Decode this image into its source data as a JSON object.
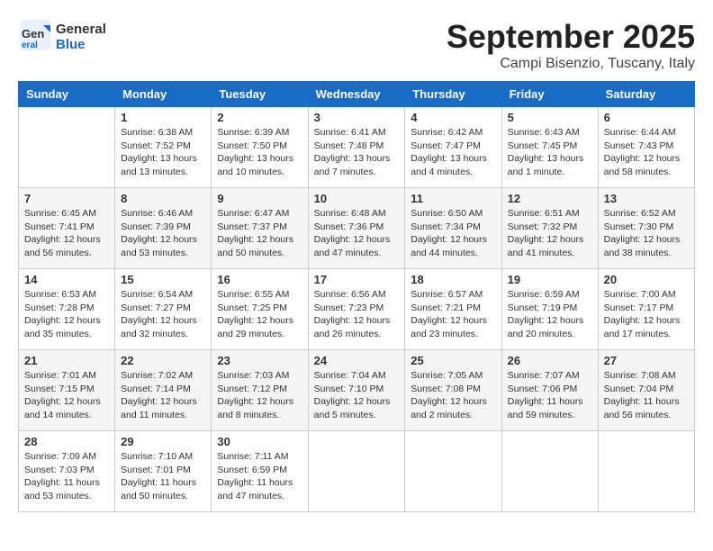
{
  "header": {
    "logo_line1": "General",
    "logo_line2": "Blue",
    "month": "September 2025",
    "location": "Campi Bisenzio, Tuscany, Italy"
  },
  "days_of_week": [
    "Sunday",
    "Monday",
    "Tuesday",
    "Wednesday",
    "Thursday",
    "Friday",
    "Saturday"
  ],
  "weeks": [
    [
      {
        "day": "",
        "info": ""
      },
      {
        "day": "1",
        "info": "Sunrise: 6:38 AM\nSunset: 7:52 PM\nDaylight: 13 hours\nand 13 minutes."
      },
      {
        "day": "2",
        "info": "Sunrise: 6:39 AM\nSunset: 7:50 PM\nDaylight: 13 hours\nand 10 minutes."
      },
      {
        "day": "3",
        "info": "Sunrise: 6:41 AM\nSunset: 7:48 PM\nDaylight: 13 hours\nand 7 minutes."
      },
      {
        "day": "4",
        "info": "Sunrise: 6:42 AM\nSunset: 7:47 PM\nDaylight: 13 hours\nand 4 minutes."
      },
      {
        "day": "5",
        "info": "Sunrise: 6:43 AM\nSunset: 7:45 PM\nDaylight: 13 hours\nand 1 minute."
      },
      {
        "day": "6",
        "info": "Sunrise: 6:44 AM\nSunset: 7:43 PM\nDaylight: 12 hours\nand 58 minutes."
      }
    ],
    [
      {
        "day": "7",
        "info": "Sunrise: 6:45 AM\nSunset: 7:41 PM\nDaylight: 12 hours\nand 56 minutes."
      },
      {
        "day": "8",
        "info": "Sunrise: 6:46 AM\nSunset: 7:39 PM\nDaylight: 12 hours\nand 53 minutes."
      },
      {
        "day": "9",
        "info": "Sunrise: 6:47 AM\nSunset: 7:37 PM\nDaylight: 12 hours\nand 50 minutes."
      },
      {
        "day": "10",
        "info": "Sunrise: 6:48 AM\nSunset: 7:36 PM\nDaylight: 12 hours\nand 47 minutes."
      },
      {
        "day": "11",
        "info": "Sunrise: 6:50 AM\nSunset: 7:34 PM\nDaylight: 12 hours\nand 44 minutes."
      },
      {
        "day": "12",
        "info": "Sunrise: 6:51 AM\nSunset: 7:32 PM\nDaylight: 12 hours\nand 41 minutes."
      },
      {
        "day": "13",
        "info": "Sunrise: 6:52 AM\nSunset: 7:30 PM\nDaylight: 12 hours\nand 38 minutes."
      }
    ],
    [
      {
        "day": "14",
        "info": "Sunrise: 6:53 AM\nSunset: 7:28 PM\nDaylight: 12 hours\nand 35 minutes."
      },
      {
        "day": "15",
        "info": "Sunrise: 6:54 AM\nSunset: 7:27 PM\nDaylight: 12 hours\nand 32 minutes."
      },
      {
        "day": "16",
        "info": "Sunrise: 6:55 AM\nSunset: 7:25 PM\nDaylight: 12 hours\nand 29 minutes."
      },
      {
        "day": "17",
        "info": "Sunrise: 6:56 AM\nSunset: 7:23 PM\nDaylight: 12 hours\nand 26 minutes."
      },
      {
        "day": "18",
        "info": "Sunrise: 6:57 AM\nSunset: 7:21 PM\nDaylight: 12 hours\nand 23 minutes."
      },
      {
        "day": "19",
        "info": "Sunrise: 6:59 AM\nSunset: 7:19 PM\nDaylight: 12 hours\nand 20 minutes."
      },
      {
        "day": "20",
        "info": "Sunrise: 7:00 AM\nSunset: 7:17 PM\nDaylight: 12 hours\nand 17 minutes."
      }
    ],
    [
      {
        "day": "21",
        "info": "Sunrise: 7:01 AM\nSunset: 7:15 PM\nDaylight: 12 hours\nand 14 minutes."
      },
      {
        "day": "22",
        "info": "Sunrise: 7:02 AM\nSunset: 7:14 PM\nDaylight: 12 hours\nand 11 minutes."
      },
      {
        "day": "23",
        "info": "Sunrise: 7:03 AM\nSunset: 7:12 PM\nDaylight: 12 hours\nand 8 minutes."
      },
      {
        "day": "24",
        "info": "Sunrise: 7:04 AM\nSunset: 7:10 PM\nDaylight: 12 hours\nand 5 minutes."
      },
      {
        "day": "25",
        "info": "Sunrise: 7:05 AM\nSunset: 7:08 PM\nDaylight: 12 hours\nand 2 minutes."
      },
      {
        "day": "26",
        "info": "Sunrise: 7:07 AM\nSunset: 7:06 PM\nDaylight: 11 hours\nand 59 minutes."
      },
      {
        "day": "27",
        "info": "Sunrise: 7:08 AM\nSunset: 7:04 PM\nDaylight: 11 hours\nand 56 minutes."
      }
    ],
    [
      {
        "day": "28",
        "info": "Sunrise: 7:09 AM\nSunset: 7:03 PM\nDaylight: 11 hours\nand 53 minutes."
      },
      {
        "day": "29",
        "info": "Sunrise: 7:10 AM\nSunset: 7:01 PM\nDaylight: 11 hours\nand 50 minutes."
      },
      {
        "day": "30",
        "info": "Sunrise: 7:11 AM\nSunset: 6:59 PM\nDaylight: 11 hours\nand 47 minutes."
      },
      {
        "day": "",
        "info": ""
      },
      {
        "day": "",
        "info": ""
      },
      {
        "day": "",
        "info": ""
      },
      {
        "day": "",
        "info": ""
      }
    ]
  ]
}
